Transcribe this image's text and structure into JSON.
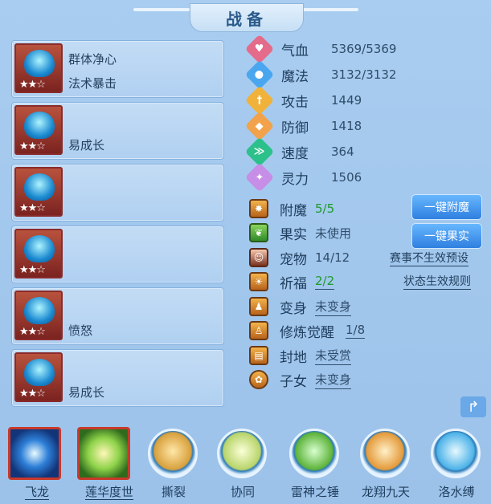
{
  "title": "战备",
  "slots": [
    {
      "line1": "群体净心",
      "line2": "法术暴击",
      "stars": "★★☆"
    },
    {
      "line1": "",
      "line2": "易成长",
      "stars": "★★☆"
    },
    {
      "line1": "",
      "line2": "",
      "stars": "★★☆"
    },
    {
      "line1": "",
      "line2": "",
      "stars": "★★☆"
    },
    {
      "line1": "",
      "line2": "愤怒",
      "stars": "★★☆"
    },
    {
      "line1": "",
      "line2": "易成长",
      "stars": "★★☆"
    }
  ],
  "stats": [
    {
      "label": "气血",
      "value": "5369/5369",
      "icon": "heart-icon",
      "color": "#e56b8a"
    },
    {
      "label": "魔法",
      "value": "3132/3132",
      "icon": "mana-icon",
      "color": "#4aa7ef"
    },
    {
      "label": "攻击",
      "value": "1449",
      "icon": "sword-icon",
      "color": "#f0b23a"
    },
    {
      "label": "防御",
      "value": "1418",
      "icon": "shield-icon",
      "color": "#f2a24a"
    },
    {
      "label": "速度",
      "value": "364",
      "icon": "speed-icon",
      "color": "#2cc08a"
    },
    {
      "label": "灵力",
      "value": "1506",
      "icon": "spirit-icon",
      "color": "#c68ee6"
    }
  ],
  "rows": [
    {
      "label": "附魔",
      "value": "5/5",
      "icon": "enchant-icon"
    },
    {
      "label": "果实",
      "value": "未使用",
      "icon": "fruit-icon"
    },
    {
      "label": "宠物",
      "value": "14/12",
      "icon": "pet-icon"
    },
    {
      "label": "祈福",
      "value": "2/2",
      "icon": "blessing-icon"
    },
    {
      "label": "变身",
      "value": "未变身",
      "icon": "transform-icon"
    },
    {
      "label": "修炼觉醒",
      "value": "1/8",
      "icon": "cultivation-icon"
    },
    {
      "label": "封地",
      "value": "未受赏",
      "icon": "fief-icon"
    },
    {
      "label": "子女",
      "value": "未变身",
      "icon": "children-icon"
    }
  ],
  "buttons": {
    "enchant": "一键附魔",
    "fruit": "一键果实"
  },
  "links": {
    "preset": "赛事不生效预设",
    "rules": "状态生效规则"
  },
  "skills": [
    {
      "name": "飞龙"
    },
    {
      "name": "莲华度世"
    },
    {
      "name": "撕裂"
    },
    {
      "name": "协同"
    },
    {
      "name": "雷神之锤"
    },
    {
      "name": "龙翔九天"
    },
    {
      "name": "洛水缚"
    }
  ]
}
